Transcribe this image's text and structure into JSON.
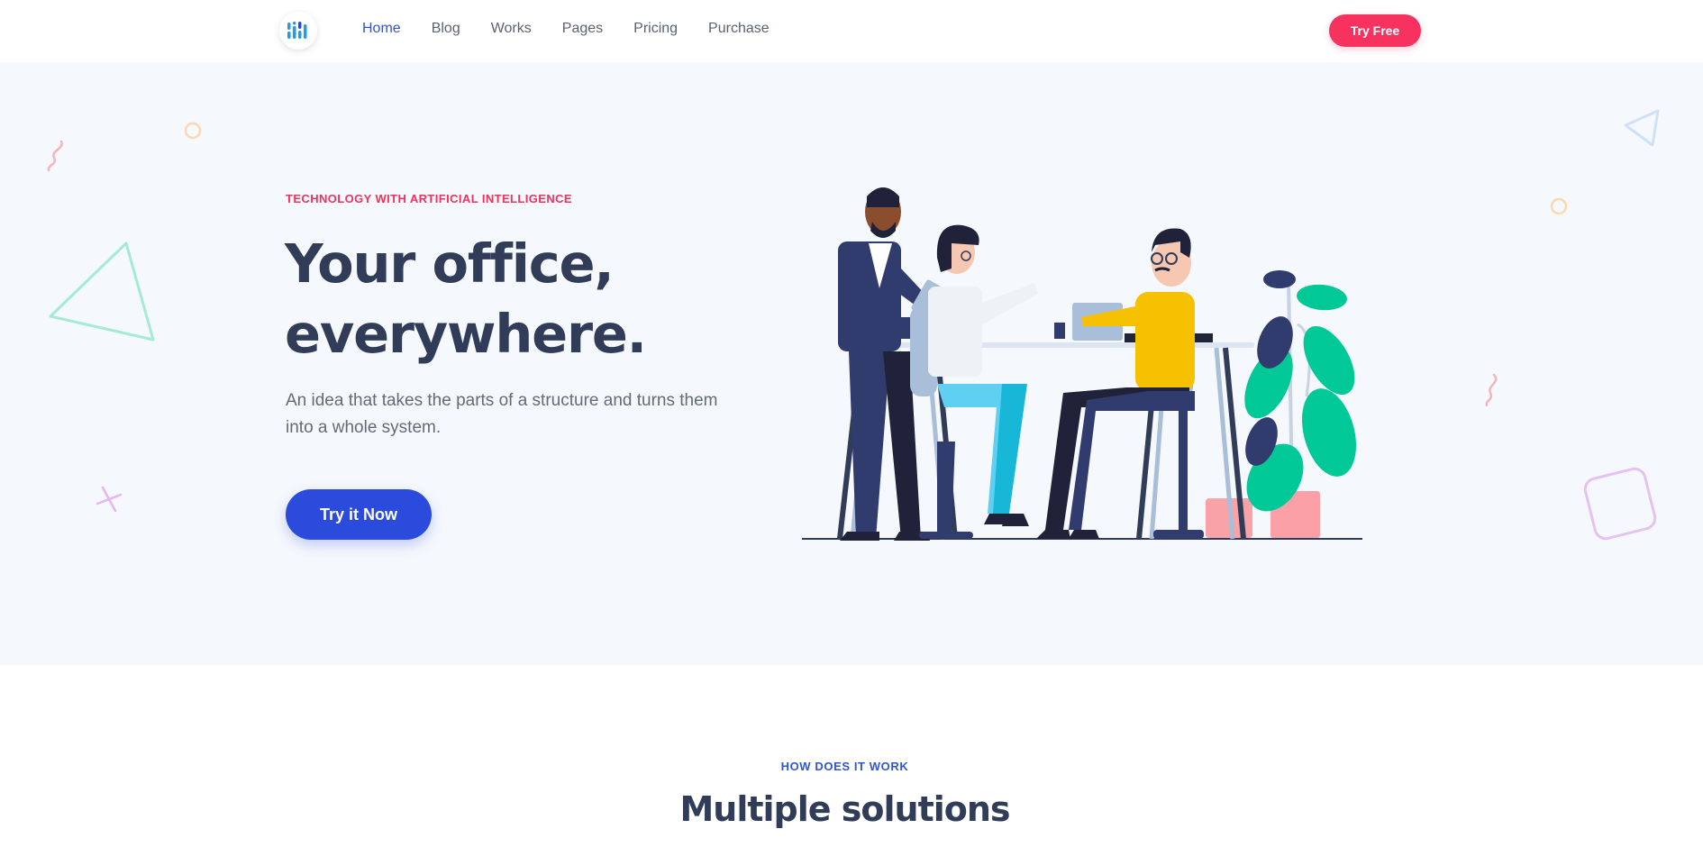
{
  "nav": {
    "items": [
      {
        "label": "Home",
        "active": true
      },
      {
        "label": "Blog",
        "active": false
      },
      {
        "label": "Works",
        "active": false
      },
      {
        "label": "Pages",
        "active": false
      },
      {
        "label": "Pricing",
        "active": false
      },
      {
        "label": "Purchase",
        "active": false
      }
    ],
    "cta_label": "Try Free"
  },
  "hero": {
    "eyebrow": "TECHNOLOGY WITH ARTIFICIAL INTELLIGENCE",
    "title_line1": "Your office,",
    "title_line2": "everywhere.",
    "lead": "An idea that takes the parts of a structure and turns them into a whole system.",
    "cta_label": "Try it Now"
  },
  "section": {
    "eyebrow": "HOW DOES IT WORK",
    "title": "Multiple solutions"
  },
  "colors": {
    "primary": "#2a4bdc",
    "accent": "#f7325e",
    "heading": "#313c59",
    "hero_bg": "#f5f8fd"
  },
  "icons": {
    "logo": "logo-icon"
  }
}
